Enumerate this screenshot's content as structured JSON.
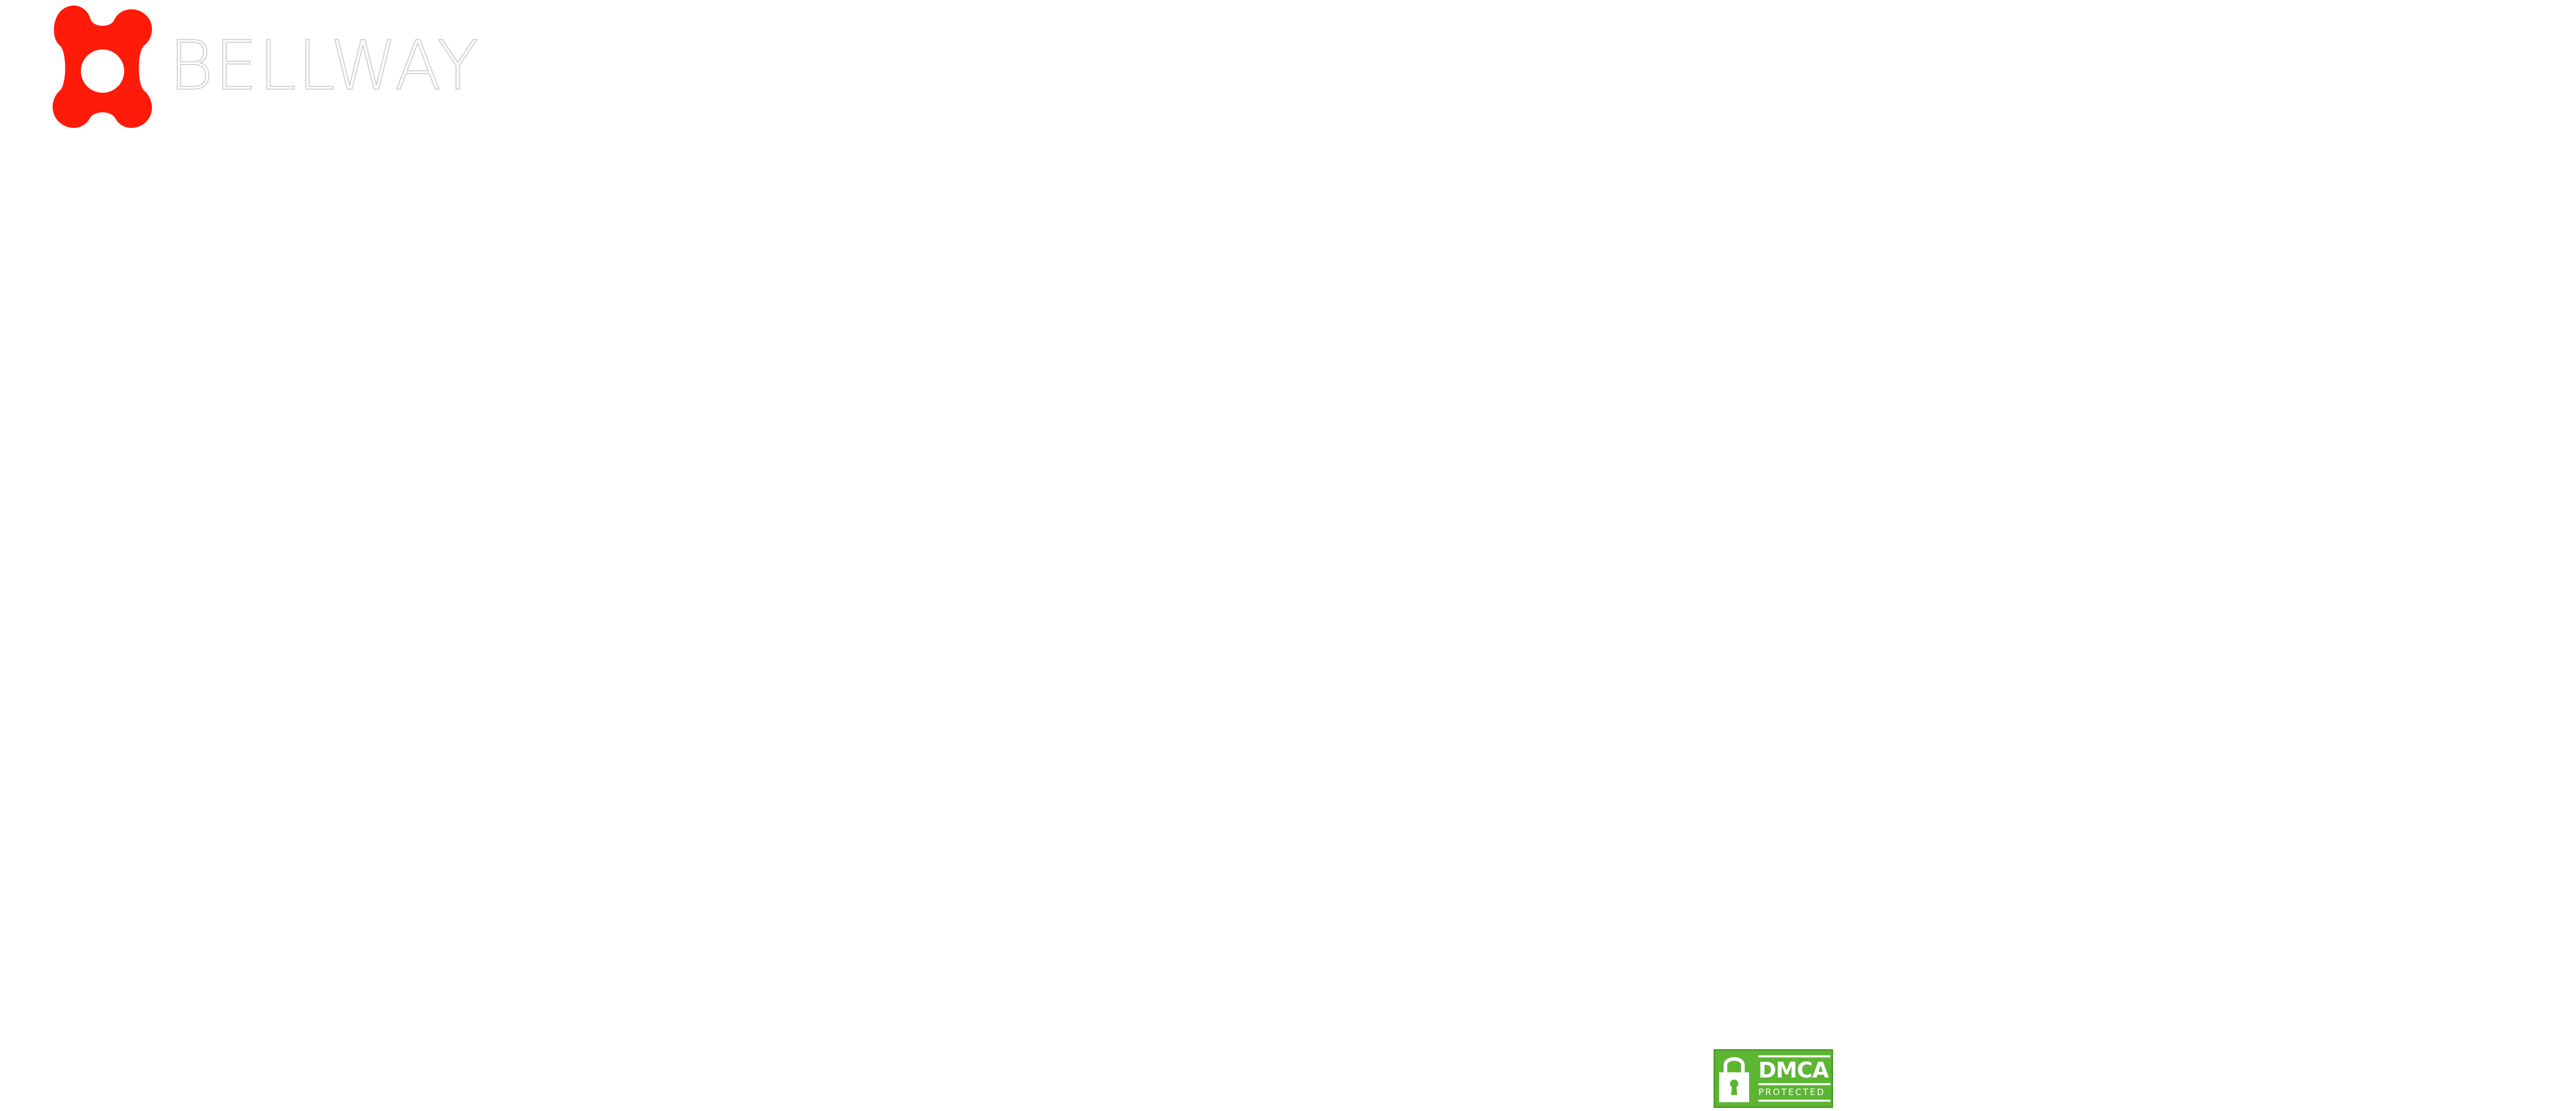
{
  "brand": {
    "name": "BELLWAY",
    "mark_icon": "bellway-cross-logo-icon",
    "mark_color": "#ff1a0a",
    "wordmark_stroke_color": "#cfcfcf"
  },
  "dmca_badge": {
    "title": "DMCA",
    "subtitle": "PROTECTED",
    "icon": "padlock-icon",
    "color": "#5cb533"
  }
}
